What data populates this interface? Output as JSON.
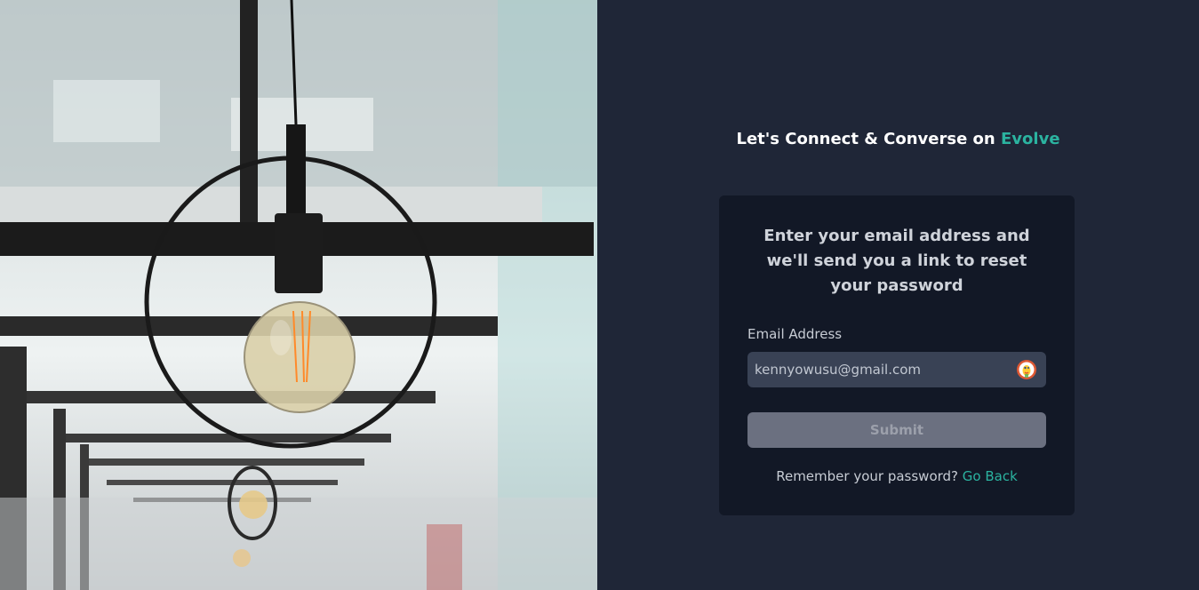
{
  "hero": {
    "image_icon": "hanging-light-bulb-photo"
  },
  "headline": {
    "prefix": "Let's Connect & Converse on ",
    "brand": "Evolve"
  },
  "card": {
    "title": "Enter your email address and we'll send you a link to reset your password",
    "email_label": "Email Address",
    "email_value": "kennyowusu@gmail.com",
    "autofill_icon": "duckduckgo-icon",
    "submit_label": "Submit",
    "remember_text": "Remember your password? ",
    "go_back_link": "Go Back"
  },
  "colors": {
    "background": "#1f2637",
    "card": "#121826",
    "accent": "#2bb3a0",
    "input": "#394255",
    "submit_disabled": "#6b7080"
  }
}
